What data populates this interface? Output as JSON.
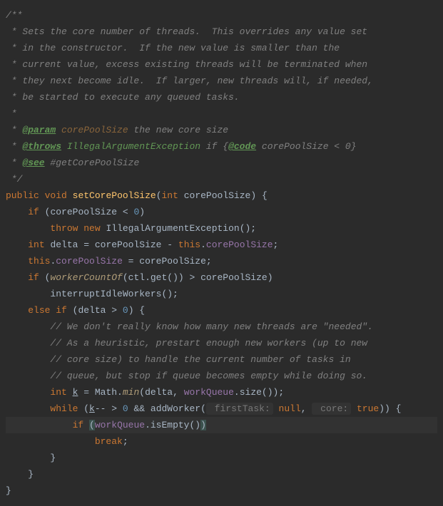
{
  "doc": {
    "l1": "/**",
    "l2_a": " * Sets the core number of threads.  This overrides any value set",
    "l3_a": " * in the constructor.  If the new value is smaller than the",
    "l4_a": " * current value, excess existing threads will be terminated when",
    "l5_a": " * they next become idle.  If larger, new threads will, if needed,",
    "l6_a": " * be started to execute any queued tasks.",
    "l7": " *",
    "l8_pre": " * ",
    "l8_tag": "@param",
    "l8_id": " corePoolSize",
    "l8_rest": " the new core size",
    "l9_pre": " * ",
    "l9_tag": "@throws",
    "l9_type": " IllegalArgumentException",
    "l9_rest": " if {",
    "l9_code": "@code",
    "l9_rest2": " corePoolSize < 0}",
    "l10_pre": " * ",
    "l10_tag": "@see",
    "l10_rest": " #getCorePoolSize",
    "l11": " */"
  },
  "code": {
    "sig_public": "public",
    "sig_void": "void",
    "sig_name": "setCorePoolSize",
    "sig_int": "int",
    "sig_param": "corePoolSize",
    "if1_if": "if",
    "if1_cond_a": "(corePoolSize < ",
    "if1_zero": "0",
    "if1_cond_b": ")",
    "throw_kw": "throw",
    "new_kw": "new",
    "exc": "IllegalArgumentException",
    "exc_tail": "();",
    "decl_int": "int",
    "decl_name": "delta",
    "decl_eq": " = corePoolSize - ",
    "decl_this": "this",
    "decl_dot": ".",
    "decl_field": "corePoolSize",
    "decl_semi": ";",
    "asn_this": "this",
    "asn_dot": ".",
    "asn_field": "corePoolSize",
    "asn_rest": " = corePoolSize;",
    "if2_if": "if",
    "if2_op": " (",
    "if2_call": "workerCountOf",
    "if2_mid": "(ctl.get()) > corePoolSize)",
    "intr": "interruptIdleWorkers();",
    "else_kw": "else",
    "elif_kw": "if",
    "elif_cond_a": " (delta > ",
    "elif_zero": "0",
    "elif_cond_b": ") {",
    "cm1": "// We don't really know how many new threads are \"needed\".",
    "cm2": "// As a heuristic, prestart enough new workers (up to new",
    "cm3": "// core size) to handle the current number of tasks in",
    "cm4": "// queue, but stop if queue becomes empty while doing so.",
    "k_int": "int",
    "k_name": "k",
    "k_eq": " = Math.",
    "k_min": "min",
    "k_op": "(delta, ",
    "k_wq": "workQueue",
    "k_tail": ".size());",
    "wh_kw": "while",
    "wh_a": " (",
    "wh_k": "k",
    "wh_b": "-- > ",
    "wh_zero": "0",
    "wh_c": " && addWorker(",
    "wh_h1": " firstTask:",
    "wh_null": "null",
    "wh_comma": ", ",
    "wh_h2": " core:",
    "wh_true": "true",
    "wh_d": ")) {",
    "if3_if": "if",
    "if3_a": " ",
    "if3_op": "(",
    "if3_wq": "workQueue",
    "if3_b": ".isEmpty()",
    "if3_cl": ")",
    "brk": "break",
    "rb1": "}",
    "rb2": "}",
    "rb3": "}"
  }
}
